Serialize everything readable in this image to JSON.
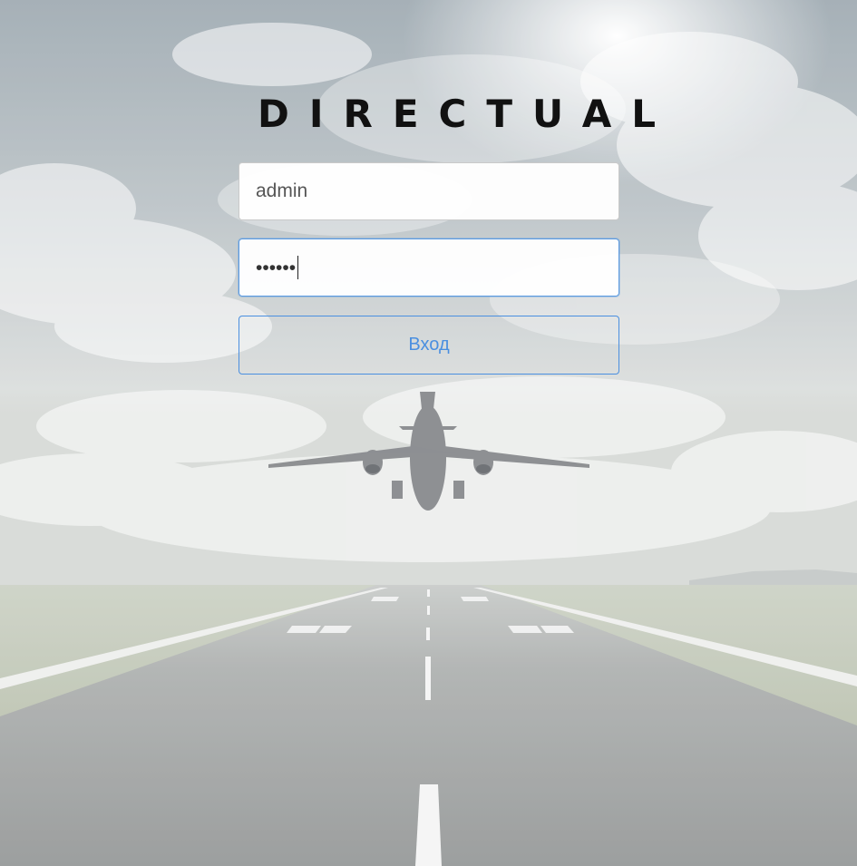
{
  "brand": {
    "logo_text": "DIRECTUAL"
  },
  "login_form": {
    "username_value": "admin",
    "password_masked": "••••••",
    "submit_label": "Вход"
  },
  "colors": {
    "accent": "#4a8fe0",
    "logo": "#111111"
  },
  "background": {
    "scene": "airplane-taking-off-runway-sky"
  }
}
